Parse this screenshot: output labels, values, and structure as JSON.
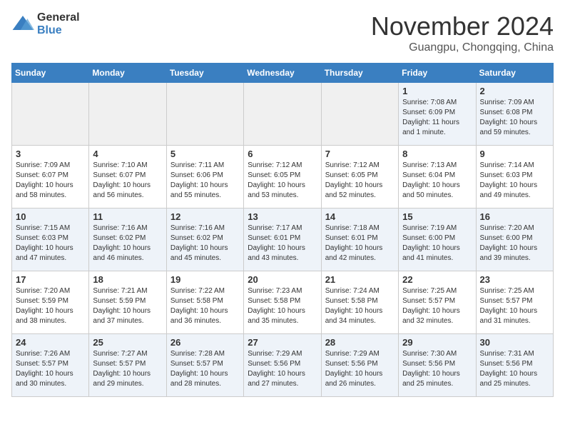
{
  "header": {
    "logo_general": "General",
    "logo_blue": "Blue",
    "month_title": "November 2024",
    "location": "Guangpu, Chongqing, China"
  },
  "days_of_week": [
    "Sunday",
    "Monday",
    "Tuesday",
    "Wednesday",
    "Thursday",
    "Friday",
    "Saturday"
  ],
  "weeks": [
    [
      {
        "day": "",
        "info": ""
      },
      {
        "day": "",
        "info": ""
      },
      {
        "day": "",
        "info": ""
      },
      {
        "day": "",
        "info": ""
      },
      {
        "day": "",
        "info": ""
      },
      {
        "day": "1",
        "info": "Sunrise: 7:08 AM\nSunset: 6:09 PM\nDaylight: 11 hours and 1 minute."
      },
      {
        "day": "2",
        "info": "Sunrise: 7:09 AM\nSunset: 6:08 PM\nDaylight: 10 hours and 59 minutes."
      }
    ],
    [
      {
        "day": "3",
        "info": "Sunrise: 7:09 AM\nSunset: 6:07 PM\nDaylight: 10 hours and 58 minutes."
      },
      {
        "day": "4",
        "info": "Sunrise: 7:10 AM\nSunset: 6:07 PM\nDaylight: 10 hours and 56 minutes."
      },
      {
        "day": "5",
        "info": "Sunrise: 7:11 AM\nSunset: 6:06 PM\nDaylight: 10 hours and 55 minutes."
      },
      {
        "day": "6",
        "info": "Sunrise: 7:12 AM\nSunset: 6:05 PM\nDaylight: 10 hours and 53 minutes."
      },
      {
        "day": "7",
        "info": "Sunrise: 7:12 AM\nSunset: 6:05 PM\nDaylight: 10 hours and 52 minutes."
      },
      {
        "day": "8",
        "info": "Sunrise: 7:13 AM\nSunset: 6:04 PM\nDaylight: 10 hours and 50 minutes."
      },
      {
        "day": "9",
        "info": "Sunrise: 7:14 AM\nSunset: 6:03 PM\nDaylight: 10 hours and 49 minutes."
      }
    ],
    [
      {
        "day": "10",
        "info": "Sunrise: 7:15 AM\nSunset: 6:03 PM\nDaylight: 10 hours and 47 minutes."
      },
      {
        "day": "11",
        "info": "Sunrise: 7:16 AM\nSunset: 6:02 PM\nDaylight: 10 hours and 46 minutes."
      },
      {
        "day": "12",
        "info": "Sunrise: 7:16 AM\nSunset: 6:02 PM\nDaylight: 10 hours and 45 minutes."
      },
      {
        "day": "13",
        "info": "Sunrise: 7:17 AM\nSunset: 6:01 PM\nDaylight: 10 hours and 43 minutes."
      },
      {
        "day": "14",
        "info": "Sunrise: 7:18 AM\nSunset: 6:01 PM\nDaylight: 10 hours and 42 minutes."
      },
      {
        "day": "15",
        "info": "Sunrise: 7:19 AM\nSunset: 6:00 PM\nDaylight: 10 hours and 41 minutes."
      },
      {
        "day": "16",
        "info": "Sunrise: 7:20 AM\nSunset: 6:00 PM\nDaylight: 10 hours and 39 minutes."
      }
    ],
    [
      {
        "day": "17",
        "info": "Sunrise: 7:20 AM\nSunset: 5:59 PM\nDaylight: 10 hours and 38 minutes."
      },
      {
        "day": "18",
        "info": "Sunrise: 7:21 AM\nSunset: 5:59 PM\nDaylight: 10 hours and 37 minutes."
      },
      {
        "day": "19",
        "info": "Sunrise: 7:22 AM\nSunset: 5:58 PM\nDaylight: 10 hours and 36 minutes."
      },
      {
        "day": "20",
        "info": "Sunrise: 7:23 AM\nSunset: 5:58 PM\nDaylight: 10 hours and 35 minutes."
      },
      {
        "day": "21",
        "info": "Sunrise: 7:24 AM\nSunset: 5:58 PM\nDaylight: 10 hours and 34 minutes."
      },
      {
        "day": "22",
        "info": "Sunrise: 7:25 AM\nSunset: 5:57 PM\nDaylight: 10 hours and 32 minutes."
      },
      {
        "day": "23",
        "info": "Sunrise: 7:25 AM\nSunset: 5:57 PM\nDaylight: 10 hours and 31 minutes."
      }
    ],
    [
      {
        "day": "24",
        "info": "Sunrise: 7:26 AM\nSunset: 5:57 PM\nDaylight: 10 hours and 30 minutes."
      },
      {
        "day": "25",
        "info": "Sunrise: 7:27 AM\nSunset: 5:57 PM\nDaylight: 10 hours and 29 minutes."
      },
      {
        "day": "26",
        "info": "Sunrise: 7:28 AM\nSunset: 5:57 PM\nDaylight: 10 hours and 28 minutes."
      },
      {
        "day": "27",
        "info": "Sunrise: 7:29 AM\nSunset: 5:56 PM\nDaylight: 10 hours and 27 minutes."
      },
      {
        "day": "28",
        "info": "Sunrise: 7:29 AM\nSunset: 5:56 PM\nDaylight: 10 hours and 26 minutes."
      },
      {
        "day": "29",
        "info": "Sunrise: 7:30 AM\nSunset: 5:56 PM\nDaylight: 10 hours and 25 minutes."
      },
      {
        "day": "30",
        "info": "Sunrise: 7:31 AM\nSunset: 5:56 PM\nDaylight: 10 hours and 25 minutes."
      }
    ]
  ]
}
